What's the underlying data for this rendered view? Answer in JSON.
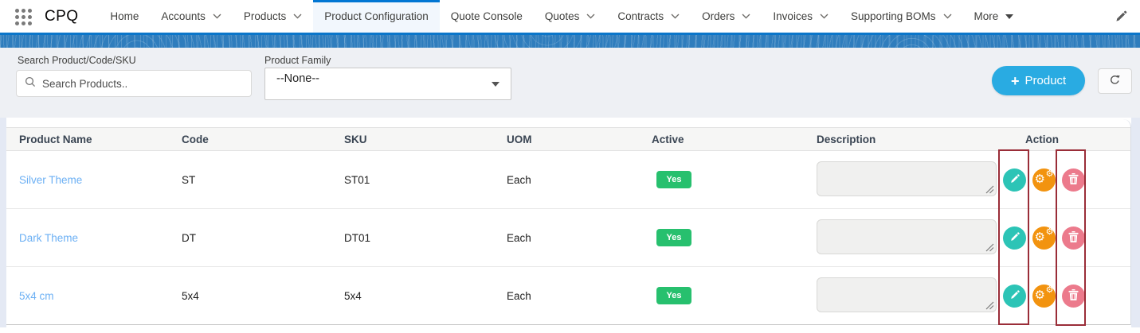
{
  "nav": {
    "app_name": "CPQ",
    "items": [
      {
        "label": "Home"
      },
      {
        "label": "Accounts"
      },
      {
        "label": "Products"
      },
      {
        "label": "Product Configuration"
      },
      {
        "label": "Quote Console"
      },
      {
        "label": "Quotes"
      },
      {
        "label": "Contracts"
      },
      {
        "label": "Orders"
      },
      {
        "label": "Invoices"
      },
      {
        "label": "Supporting BOMs"
      },
      {
        "label": "More"
      }
    ],
    "active_item": "Product Configuration"
  },
  "filters": {
    "search_label": "Search Product/Code/SKU",
    "search_placeholder": "Search Products..",
    "search_value": "",
    "family_label": "Product Family",
    "family_value": "--None--",
    "add_plus": "+",
    "add_label": "Product"
  },
  "table": {
    "headers": [
      "Product Name",
      "Code",
      "SKU",
      "UOM",
      "Active",
      "Description",
      "Action"
    ],
    "rows": [
      {
        "name": "Silver Theme",
        "code": "ST",
        "sku": "ST01",
        "uom": "Each",
        "active": "Yes",
        "description": ""
      },
      {
        "name": "Dark Theme",
        "code": "DT",
        "sku": "DT01",
        "uom": "Each",
        "active": "Yes",
        "description": ""
      },
      {
        "name": "5x4 cm",
        "code": "5x4",
        "sku": "5x4",
        "uom": "Each",
        "active": "Yes",
        "description": ""
      }
    ]
  },
  "icons": {
    "gear_glyph": "⚙"
  },
  "colors": {
    "nav_active_bar": "#0176d3",
    "nav_underline": "#0b76ca",
    "band_blue": "#2f7dbd",
    "add_button": "#29abe2",
    "badge_green": "#27c06e",
    "edit_teal": "#2cc4b6",
    "config_orange": "#f2930f",
    "delete_pink": "#ec7a8c",
    "annotation_red": "#9a2d38",
    "link_blue": "#6cb0f4"
  }
}
